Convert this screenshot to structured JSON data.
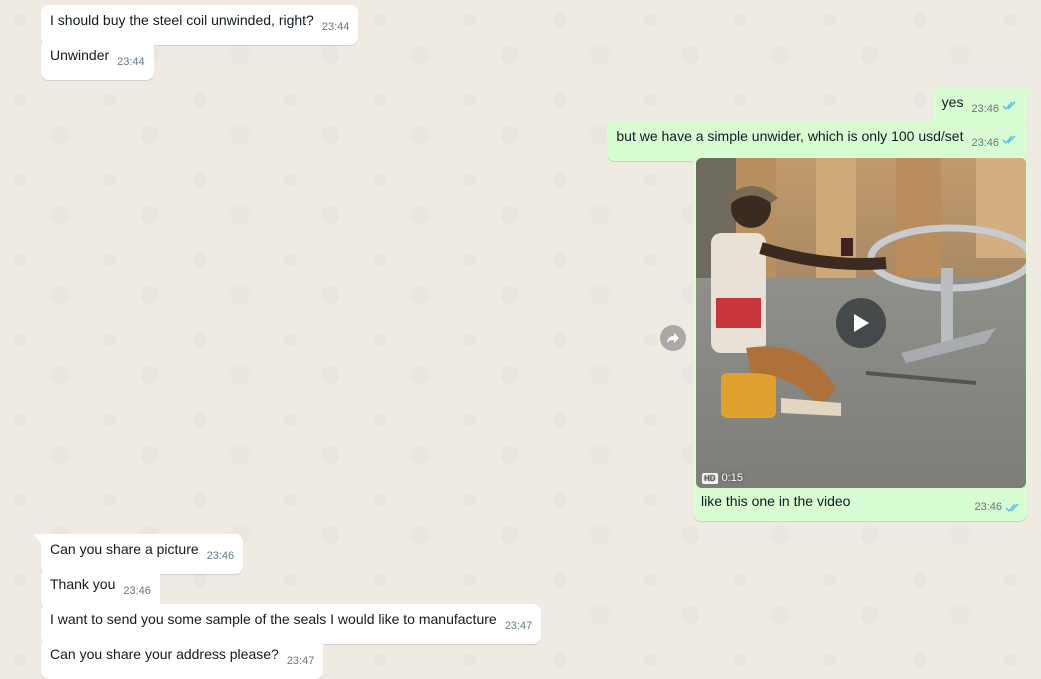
{
  "messages": [
    {
      "text": "I should buy the steel coil unwinded, right?",
      "time": "23:44"
    },
    {
      "text": "Unwinder",
      "time": "23:44"
    },
    {
      "text": "yes",
      "time": "23:46"
    },
    {
      "text": "but we have a simple unwider, which is only 100 usd/set",
      "time": "23:46"
    },
    {
      "text": "Can you share a picture",
      "time": "23:46"
    },
    {
      "text": "Thank you",
      "time": "23:46"
    },
    {
      "text": "I want to send you some sample of the seals I would like to manufacture",
      "time": "23:47"
    },
    {
      "text": "Can you share your address please?",
      "time": "23:47"
    }
  ],
  "video_message": {
    "duration": "0:15",
    "hd_label": "HD",
    "caption": "like this one in the video",
    "time": "23:46"
  },
  "icons": {
    "read_ticks": "double-check-icon",
    "play": "play-icon",
    "forward": "forward-icon"
  },
  "colors": {
    "background": "#efeae2",
    "incoming_bubble": "#ffffff",
    "outgoing_bubble": "#d9fdd3",
    "read_ticks": "#53bdeb",
    "timestamp": "#667781"
  }
}
